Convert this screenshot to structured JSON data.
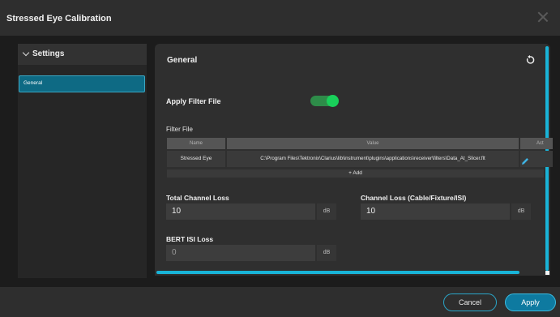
{
  "window": {
    "title": "Stressed Eye Calibration"
  },
  "sidebar": {
    "section_label": "Settings",
    "items": [
      {
        "label": "General",
        "selected": true
      }
    ]
  },
  "panel": {
    "title": "General",
    "apply_filter": {
      "label": "Apply Filter File",
      "on": true
    },
    "filter_file": {
      "label": "Filter File",
      "columns": [
        "Name",
        "Value",
        "Act"
      ],
      "rows": [
        {
          "name": "Stressed Eye",
          "value": "C:\\Program Files\\Tektronix\\Clarius\\lib\\instrument\\plugins\\applications\\receiver\\filters\\Data_At_Slicer.flt"
        }
      ],
      "add_label": "+ Add"
    },
    "total_channel_loss": {
      "label": "Total Channel Loss",
      "value": "10",
      "unit": "dB"
    },
    "channel_loss": {
      "label": "Channel Loss (Cable/Fixture/ISI)",
      "value": "10",
      "unit": "dB"
    },
    "bert_isi_loss": {
      "label": "BERT ISI Loss",
      "value": "0",
      "unit": "dB"
    }
  },
  "footer": {
    "cancel_label": "Cancel",
    "apply_label": "Apply"
  },
  "colors": {
    "accent": "#19b4d8",
    "selected_item": "#0e6a84",
    "toggle_on": "#19d05a",
    "primary_button": "#0e7aa0"
  },
  "icons": {
    "close": "close-icon",
    "reset": "reset-icon",
    "edit": "pencil-icon",
    "expand": "chevron-down-icon"
  }
}
